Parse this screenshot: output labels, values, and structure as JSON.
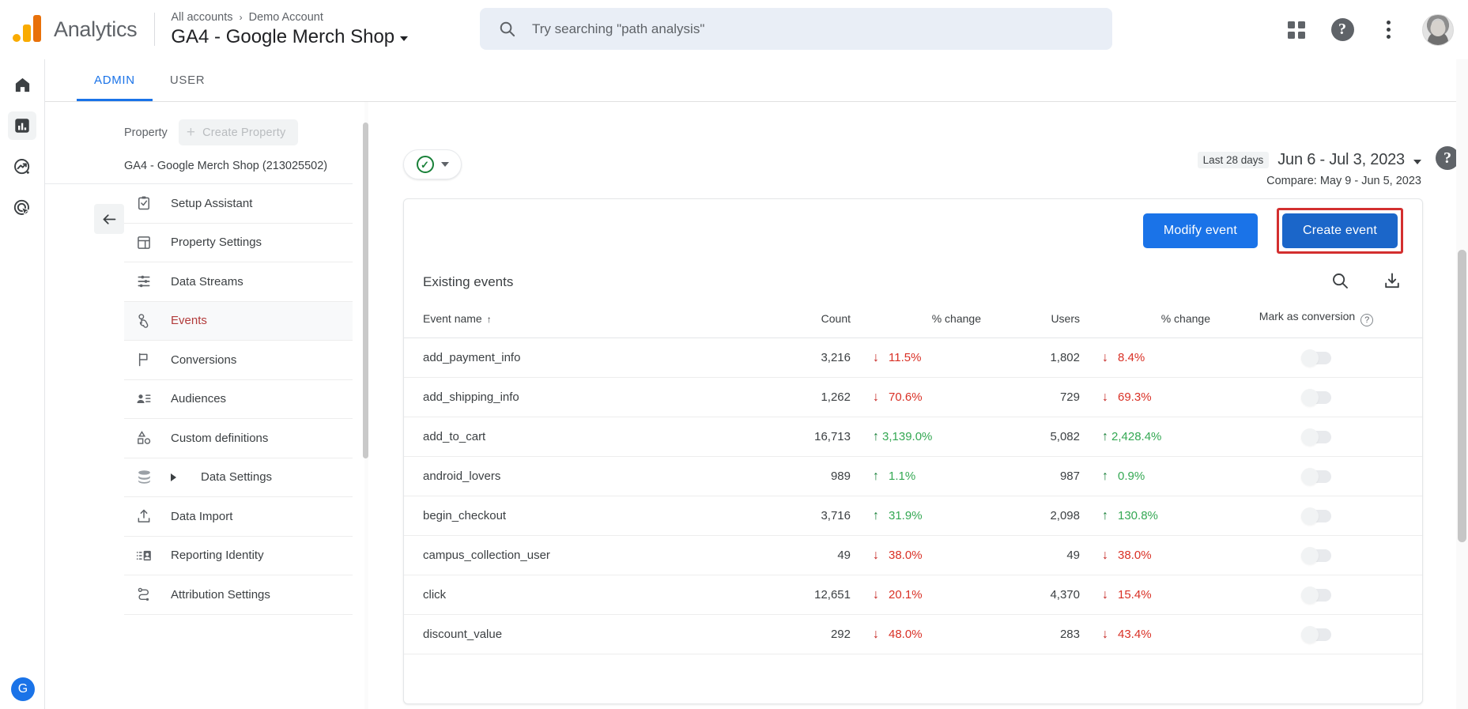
{
  "header": {
    "brand": "Analytics",
    "breadcrumb_all": "All accounts",
    "breadcrumb_sep": "›",
    "breadcrumb_account": "Demo Account",
    "property_title": "GA4 - Google Merch Shop",
    "search_placeholder": "Try searching \"path analysis\"",
    "icons": {
      "apps": "apps-grid-icon",
      "help": "help-circle-icon",
      "more": "kebab-more-icon",
      "avatar": "user-avatar"
    }
  },
  "rail": {
    "items": [
      {
        "name": "home",
        "label": "Home"
      },
      {
        "name": "reports",
        "label": "Reports"
      },
      {
        "name": "explore",
        "label": "Explore"
      },
      {
        "name": "advertising",
        "label": "Advertising"
      }
    ],
    "bottom_label": "G"
  },
  "tabs": [
    {
      "label": "ADMIN",
      "active": true
    },
    {
      "label": "USER",
      "active": false
    }
  ],
  "sidebar": {
    "property_label": "Property",
    "create_property_label": "Create Property",
    "property_name": "GA4 - Google Merch Shop (213025502)",
    "items": [
      {
        "label": "Setup Assistant",
        "icon": "clipboard-check-icon",
        "active": false,
        "expandable": false
      },
      {
        "label": "Property Settings",
        "icon": "layout-panel-icon",
        "active": false,
        "expandable": false
      },
      {
        "label": "Data Streams",
        "icon": "data-streams-icon",
        "active": false,
        "expandable": false
      },
      {
        "label": "Events",
        "icon": "tap-hand-icon",
        "active": true,
        "expandable": false
      },
      {
        "label": "Conversions",
        "icon": "flag-icon",
        "active": false,
        "expandable": false
      },
      {
        "label": "Audiences",
        "icon": "person-list-icon",
        "active": false,
        "expandable": false
      },
      {
        "label": "Custom definitions",
        "icon": "shapes-icon",
        "active": false,
        "expandable": false
      },
      {
        "label": "Data Settings",
        "icon": "database-icon",
        "active": false,
        "expandable": true
      },
      {
        "label": "Data Import",
        "icon": "upload-icon",
        "active": false,
        "expandable": false
      },
      {
        "label": "Reporting Identity",
        "icon": "id-card-icon",
        "active": false,
        "expandable": false
      },
      {
        "label": "Attribution Settings",
        "icon": "attribution-icon",
        "active": false,
        "expandable": false
      }
    ],
    "collapse_icon": "arrow-left-icon"
  },
  "main": {
    "status_badge_icon": "check-circle-green-icon",
    "date": {
      "preset": "Last 28 days",
      "range": "Jun 6 - Jul 3, 2023",
      "compare": "Compare: May 9 - Jun 5, 2023"
    },
    "help_icon": "help-circle-icon",
    "buttons": {
      "modify": "Modify event",
      "create": "Create event"
    },
    "table": {
      "title": "Existing events",
      "search_icon": "search-icon",
      "download_icon": "download-icon",
      "columns": [
        "Event name",
        "Count",
        "% change",
        "Users",
        "% change",
        "Mark as conversion"
      ],
      "sort_indicator": "↑",
      "mark_help_icon": "question-mark-icon",
      "rows": [
        {
          "event": "add_payment_info",
          "count": "3,216",
          "count_change": "11.5%",
          "count_dir": "down",
          "users": "1,802",
          "users_change": "8.4%",
          "users_dir": "down",
          "conversion": false
        },
        {
          "event": "add_shipping_info",
          "count": "1,262",
          "count_change": "70.6%",
          "count_dir": "down",
          "users": "729",
          "users_change": "69.3%",
          "users_dir": "down",
          "conversion": false
        },
        {
          "event": "add_to_cart",
          "count": "16,713",
          "count_change": "3,139.0%",
          "count_dir": "up",
          "users": "5,082",
          "users_change": "2,428.4%",
          "users_dir": "up",
          "conversion": false
        },
        {
          "event": "android_lovers",
          "count": "989",
          "count_change": "1.1%",
          "count_dir": "up",
          "users": "987",
          "users_change": "0.9%",
          "users_dir": "up",
          "conversion": false
        },
        {
          "event": "begin_checkout",
          "count": "3,716",
          "count_change": "31.9%",
          "count_dir": "up",
          "users": "2,098",
          "users_change": "130.8%",
          "users_dir": "up",
          "conversion": false
        },
        {
          "event": "campus_collection_user",
          "count": "49",
          "count_change": "38.0%",
          "count_dir": "down",
          "users": "49",
          "users_change": "38.0%",
          "users_dir": "down",
          "conversion": false
        },
        {
          "event": "click",
          "count": "12,651",
          "count_change": "20.1%",
          "count_dir": "down",
          "users": "4,370",
          "users_change": "15.4%",
          "users_dir": "down",
          "conversion": false
        },
        {
          "event": "discount_value",
          "count": "292",
          "count_change": "48.0%",
          "count_dir": "down",
          "users": "283",
          "users_change": "43.4%",
          "users_dir": "down",
          "conversion": false
        }
      ]
    }
  },
  "colors": {
    "brand_blue": "#1a73e8",
    "button_pressed": "#1b66c9",
    "highlight_red": "#d32f2f",
    "increase_green": "#34a853",
    "decrease_red": "#d93025",
    "active_nav": "#b23b3b",
    "logo_yellow": "#F9AB00",
    "logo_orange": "#E8710A"
  }
}
